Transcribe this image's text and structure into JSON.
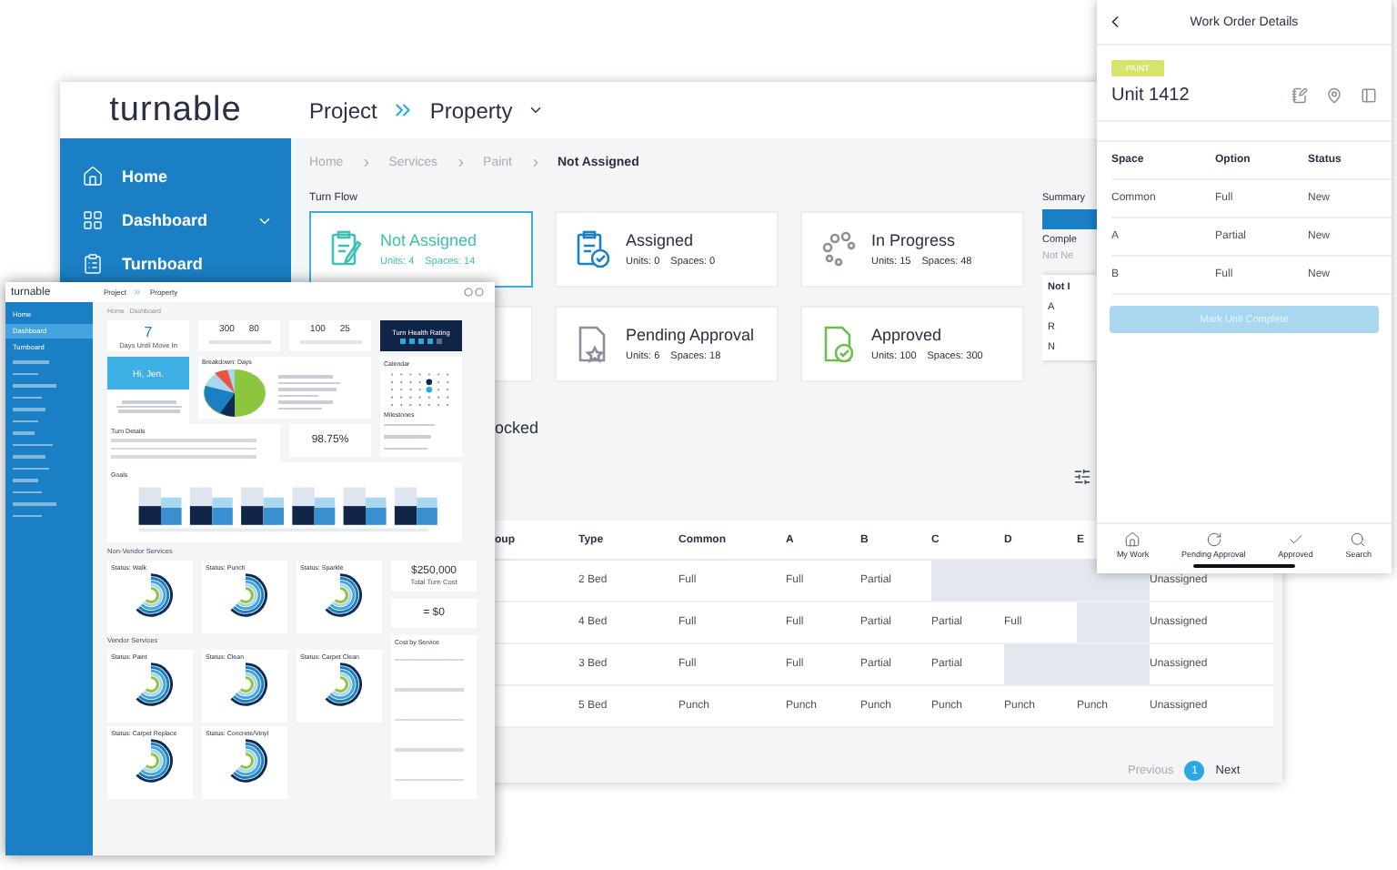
{
  "main_window": {
    "logo": "turnable",
    "header": {
      "project": "Project",
      "property": "Property"
    },
    "sidebar": [
      {
        "kind": "home",
        "label": "Home",
        "expandable": false
      },
      {
        "kind": "dashboard",
        "label": "Dashboard",
        "expandable": true
      },
      {
        "kind": "turnboard",
        "label": "Turnboard",
        "expandable": false
      }
    ],
    "breadcrumb": [
      "Home",
      "Services",
      "Paint",
      "Not Assigned"
    ],
    "turn_flow": {
      "title": "Turn Flow",
      "cards": [
        {
          "kind": "not_assigned",
          "title": "Not Assigned",
          "units": "Units: 4",
          "spaces": "Spaces: 14",
          "selected": true,
          "color": "#3ec1b4"
        },
        {
          "kind": "assigned",
          "title": "Assigned",
          "units": "Units: 0",
          "spaces": "Spaces: 0",
          "selected": false,
          "color": "#1d7fc4"
        },
        {
          "kind": "in_progress",
          "title": "In Progress",
          "units": "Units: 15",
          "spaces": "Spaces: 48",
          "selected": false,
          "color": "#8a8f98"
        },
        {
          "kind": "pending",
          "title": "Pending Approval",
          "units": "Units: 6",
          "spaces": "Spaces: 18",
          "selected": false,
          "color": "#8a8f98"
        },
        {
          "kind": "approved",
          "title": "Approved",
          "units": "Units: 100",
          "spaces": "Spaces: 300",
          "selected": false,
          "color": "#6cc04a"
        }
      ]
    },
    "summary": {
      "title": "Summary",
      "line_1": "Comple",
      "line_2": "Not Ne",
      "menu": [
        "Not I",
        "A",
        "R",
        "N"
      ]
    },
    "table": {
      "title": "ocked",
      "columns": [
        "oup",
        "Type",
        "Common",
        "A",
        "B",
        "C",
        "D",
        "E"
      ],
      "rows": [
        {
          "cells": [
            "",
            "2 Bed",
            "Full",
            "Full",
            "Partial",
            null,
            null,
            null,
            "Unassigned"
          ]
        },
        {
          "cells": [
            "",
            "4 Bed",
            "Full",
            "Full",
            "Partial",
            "Partial",
            "Full",
            null,
            "Unassigned"
          ]
        },
        {
          "cells": [
            "",
            "3 Bed",
            "Full",
            "Full",
            "Partial",
            "Partial",
            null,
            null,
            "Unassigned"
          ]
        },
        {
          "cells": [
            "",
            "5 Bed",
            "Punch",
            "Punch",
            "Punch",
            "Punch",
            "Punch",
            "Punch",
            "Unassigned"
          ]
        }
      ]
    },
    "pagination": {
      "previous": "Previous",
      "page": "1",
      "next": "Next"
    }
  },
  "mobile": {
    "title": "Work Order Details",
    "tag": "PAINT",
    "unit": "Unit 1412",
    "columns": [
      "Space",
      "Option",
      "Status"
    ],
    "rows": [
      [
        "Common",
        "Full",
        "New"
      ],
      [
        "A",
        "Partial",
        "New"
      ],
      [
        "B",
        "Full",
        "New"
      ]
    ],
    "button": {
      "label": "Mark Unit Complete",
      "disabled": true
    },
    "nav": [
      {
        "kind": "home",
        "label": "My Work"
      },
      {
        "kind": "pending",
        "label": "Pending Approval"
      },
      {
        "kind": "approved",
        "label": "Approved"
      },
      {
        "kind": "search",
        "label": "Search"
      }
    ]
  },
  "dashboard": {
    "logo": "turnable",
    "header": {
      "project": "Project",
      "property": "Property"
    },
    "sidebar": [
      {
        "label": "Home",
        "selected": false
      },
      {
        "label": "Dashboard",
        "selected": true
      },
      {
        "label": "Turnboard",
        "selected": false
      }
    ],
    "breadcrumb": [
      "Home",
      "Dashboard"
    ],
    "countdown": {
      "value": "7",
      "label": "Days Until Move In"
    },
    "stat_pairs": [
      {
        "values": [
          "300",
          "80"
        ]
      },
      {
        "values": [
          "100",
          "25"
        ]
      }
    ],
    "health": {
      "title": "Turn Health Rating",
      "stars": 4
    },
    "greeting": "Hi, Jen.",
    "breakdown_title": "Breakdown: Days",
    "calendar_title": "Calendar",
    "milestones_title": "Milestones",
    "turn_details_title": "Turn Details",
    "percentage": "98.75%",
    "goals_title": "Goals",
    "non_vendor_title": "Non-Vendor Services",
    "vendor_title": "Vendor Services",
    "non_vendor_statuses": [
      "Status: Walk",
      "Status: Punch",
      "Status: Sparkle"
    ],
    "vendor_statuses": [
      "Status: Paint",
      "Status: Clean",
      "Status: Carpet Clean",
      "Status: Carpet Replace",
      "Status: Concrete/Vinyl"
    ],
    "total_cost": {
      "value": "$250,000",
      "label": "Total Turn Cost"
    },
    "budget": "= $0",
    "cost_by_service_title": "Cost by Service"
  }
}
